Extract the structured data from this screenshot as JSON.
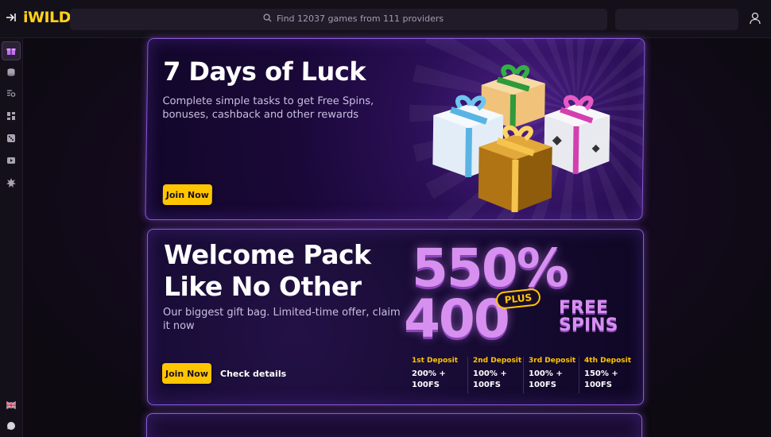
{
  "header": {
    "logo": "iWILD",
    "search_placeholder": "Find 12037 games from 111 providers"
  },
  "sidebar": {
    "items": [
      {
        "icon": "gift-icon",
        "active": true
      },
      {
        "icon": "coins-icon",
        "active": false
      },
      {
        "icon": "search-list-icon",
        "active": false
      },
      {
        "icon": "grid-icon",
        "active": false
      },
      {
        "icon": "dice-icon",
        "active": false
      },
      {
        "icon": "play-icon",
        "active": false
      },
      {
        "icon": "burst-icon",
        "active": false
      }
    ],
    "bottom": [
      {
        "icon": "uk-flag-icon"
      },
      {
        "icon": "chat-icon"
      }
    ]
  },
  "banners": {
    "luck": {
      "title": "7 Days of Luck",
      "description": "Complete simple tasks to get Free Spins, bonuses, cashback and other rewards",
      "button": "Join Now"
    },
    "welcome": {
      "title_line1": "Welcome Pack",
      "title_line2": "Like No Other",
      "description": "Our biggest gift bag. Limited-time offer, claim it now",
      "button": "Join Now",
      "link": "Check details",
      "promo_percent": "550%",
      "promo_plus": "PLUS",
      "promo_spins": "400",
      "promo_free": "FREE",
      "promo_spins_label": "SPINS",
      "deposits": [
        {
          "title": "1st Deposit",
          "line1": "200% +",
          "line2": "100FS"
        },
        {
          "title": "2nd Deposit",
          "line1": "100% +",
          "line2": "100FS"
        },
        {
          "title": "3rd Deposit",
          "line1": "100% +",
          "line2": "100FS"
        },
        {
          "title": "4th Deposit",
          "line1": "150% +",
          "line2": "100FS"
        }
      ]
    }
  },
  "colors": {
    "accent": "#ffc600",
    "brand_yellow": "#ffd21a",
    "promo_purple": "#d790f0",
    "banner_border": "#8b5bd8"
  }
}
